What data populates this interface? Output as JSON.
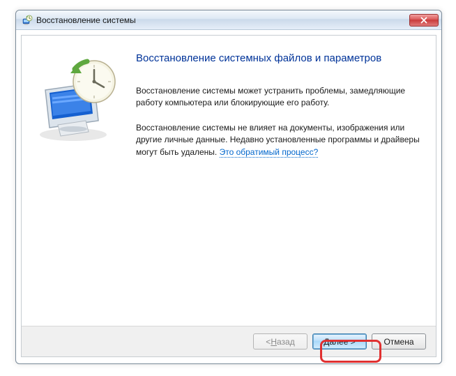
{
  "window": {
    "title": "Восстановление системы"
  },
  "content": {
    "heading": "Восстановление системных файлов и параметров",
    "para1": "Восстановление системы может устранить проблемы, замедляющие работу компьютера или блокирующие его работу.",
    "para2_a": "Восстановление системы не влияет на документы, изображения или другие личные данные. Недавно установленные программы и драйверы могут быть удалены. ",
    "para2_link": "Это обратимый процесс?"
  },
  "buttons": {
    "back_prefix": "< ",
    "back_u": "Н",
    "back_rest": "азад",
    "next_u": "Д",
    "next_rest": "алее >",
    "cancel": "Отмена"
  },
  "highlight": {
    "color": "#e03030"
  }
}
